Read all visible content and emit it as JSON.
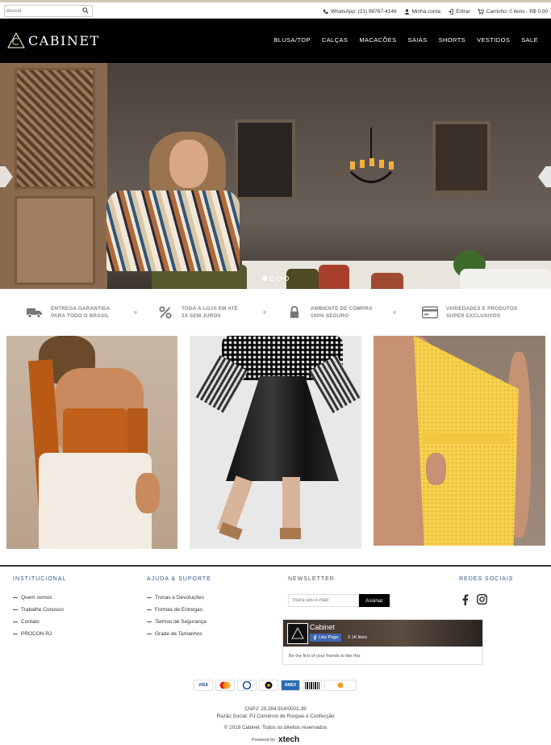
{
  "search": {
    "placeholder": "Buscar"
  },
  "topbar": {
    "whatsapp": "WhatsApp: (21) 98767-4146",
    "account": "Minha conta",
    "login": "Entrar",
    "cart": "Carrinho: 0 itens - R$ 0,00"
  },
  "brand": {
    "name": "CABINET"
  },
  "nav": [
    "BLUSA/TOP",
    "CALÇAS",
    "MACACÕES",
    "SAIAS",
    "SHORTS",
    "VESTIDOS",
    "SALE"
  ],
  "slider": {
    "total": 4,
    "active": 1
  },
  "features": [
    {
      "icon": "truck-icon",
      "line1": "ENTREGA GARANTIDA",
      "line2": "PARA TODO O BRASIL"
    },
    {
      "icon": "percent-icon",
      "line1": "TODA A LOJA EM ATÉ",
      "line2": "3X SEM JUROS"
    },
    {
      "icon": "lock-icon",
      "line1": "AMBIENTE DE COMPRA",
      "line2": "100% SEGURO"
    },
    {
      "icon": "credit-card-icon",
      "line1": "VARIEDADES E PRODUTOS",
      "line2": "SUPER EXCLUSIVOS"
    }
  ],
  "footer": {
    "institucional": {
      "title": "INSTITUCIONAL",
      "items": [
        "Quem somos",
        "Trabalhe Conosco",
        "Contato",
        "PROCON RJ"
      ]
    },
    "ajuda": {
      "title": "AJUDA & SUPORTE",
      "items": [
        "Trocas e Devoluções",
        "Formas de Entregas",
        "Termos de Segurança",
        "Grade de Tamanhos"
      ]
    },
    "newsletter": {
      "title": "NEWSLETTER",
      "placeholder": "Insira seu e-mail",
      "button": "Assinar"
    },
    "redes": {
      "title": "REDES SOCIAIS"
    },
    "facebook": {
      "name": "Cabinet",
      "like": "Like Page",
      "likes": "2.1K likes",
      "friends": "Be the first of your friends to like this"
    },
    "payments": [
      "VISA",
      "MC",
      "DC",
      "ELO",
      "AMEX",
      "BOLETO",
      "PAGSEGURO"
    ],
    "cnpj": "CNPJ: 20.284.914/0001-39",
    "razao": "Razão Social: PJ Comércio de Roupas e Confecção",
    "copyright": "© 2019 Cabinet. Todos os direitos reservados",
    "powered_label": "Powered by",
    "powered_brand": "xtech"
  },
  "colors": {
    "black": "#000000",
    "accent": "#cfc6b4",
    "footer_title": "#2a5a8a"
  }
}
